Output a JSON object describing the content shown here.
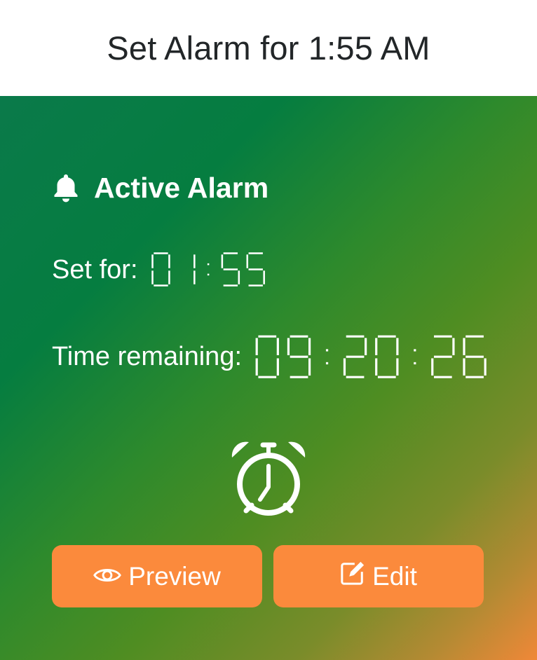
{
  "header": {
    "title": "Set Alarm for 1:55 AM"
  },
  "alarm": {
    "heading": "Active Alarm",
    "heading_icon": "bell-icon",
    "set_for_label": "Set for:",
    "set_for_value": "01:55",
    "remaining_label": "Time remaining:",
    "remaining_value": "09:20:26",
    "alarm_icon": "alarm-clock-icon"
  },
  "buttons": {
    "preview_label": "Preview",
    "preview_icon": "eye-icon",
    "edit_label": "Edit",
    "edit_icon": "edit-icon"
  },
  "colors": {
    "gradient_start": "#0a7a4a",
    "gradient_end": "#f08838",
    "button": "#fb8a3c",
    "text_dark": "#222628"
  }
}
